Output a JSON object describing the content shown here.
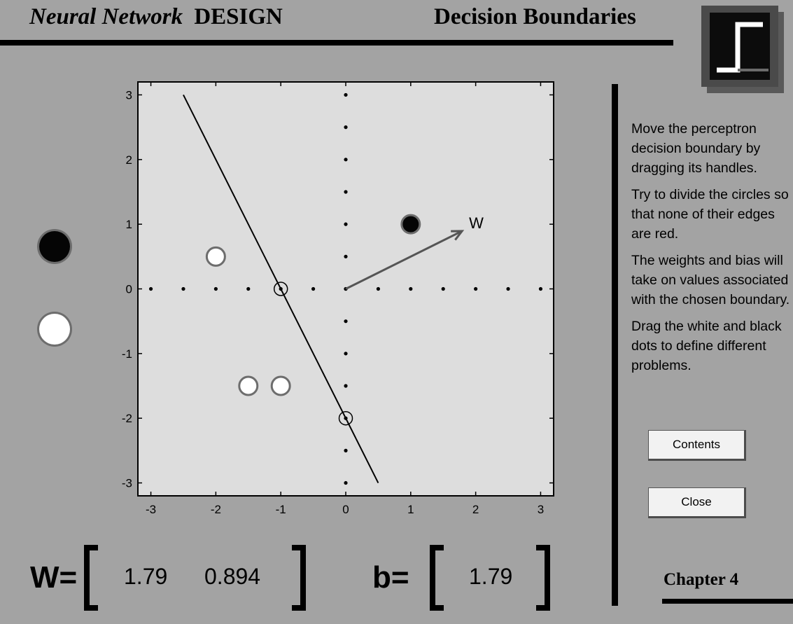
{
  "header": {
    "title_italic": "Neural Network",
    "title_bold": "DESIGN",
    "section_title": "Decision Boundaries"
  },
  "logo": {
    "icon": "step-function-icon"
  },
  "chart_data": {
    "type": "scatter",
    "title": "",
    "xlabel": "",
    "ylabel": "",
    "xlim": [
      -3.2,
      3.2
    ],
    "ylim": [
      -3.2,
      3.2
    ],
    "xticks": [
      "-3",
      "-2",
      "-1",
      "0",
      "1",
      "2",
      "3"
    ],
    "yticks": [
      "3",
      "2",
      "1",
      "0",
      "-1",
      "-2",
      "-3"
    ],
    "grid": false,
    "axis_dots": [
      -3,
      -2.5,
      -2,
      -1.5,
      -1,
      -0.5,
      0,
      0.5,
      1,
      1.5,
      2,
      2.5,
      3
    ],
    "series": [
      {
        "name": "",
        "class": "black",
        "points": [
          [
            1,
            1
          ]
        ]
      },
      {
        "name": "",
        "class": "white",
        "points": [
          [
            -2,
            0.5
          ],
          [
            -1.5,
            -1.5
          ],
          [
            -1,
            -1.5
          ]
        ]
      }
    ],
    "boundary_line": [
      [
        -2.5,
        3
      ],
      [
        0.5,
        -3
      ]
    ],
    "handles": [
      [
        -1,
        0
      ],
      [
        0,
        -2
      ]
    ],
    "weight_vector": {
      "from": [
        0,
        0
      ],
      "to": [
        1.79,
        0.894
      ],
      "label": "W"
    }
  },
  "legend": {
    "black_dot": "black-dot",
    "white_dot": "white-dot"
  },
  "equation": {
    "w_label": "W=",
    "w_values": [
      "1.79",
      "0.894"
    ],
    "b_label": "b=",
    "b_value": "1.79"
  },
  "instructions": [
    "Move the perceptron decision boundary by dragging its handles.",
    "Try to divide the circles so that none of their edges are red.",
    "The weights and bias will take on values associated with the chosen boundary.",
    "Drag the white and black dots to define different problems."
  ],
  "buttons": {
    "contents": "Contents",
    "close": "Close"
  },
  "footer": {
    "chapter": "Chapter 4"
  }
}
